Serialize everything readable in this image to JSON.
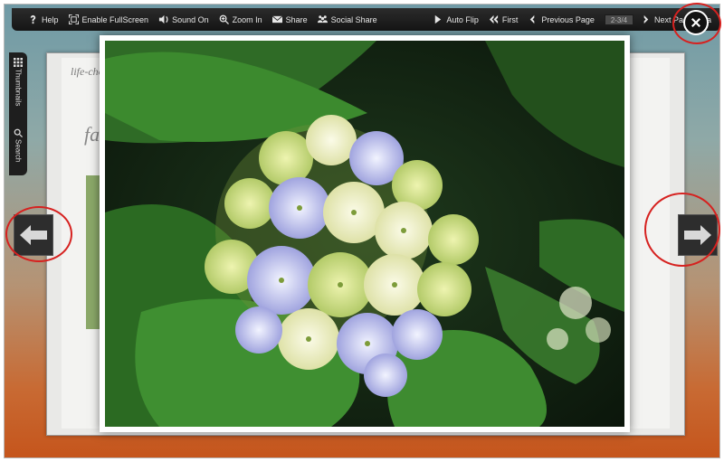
{
  "toolbar": {
    "help": "Help",
    "fullscreen": "Enable FullScreen",
    "sound": "Sound On",
    "zoom": "Zoom In",
    "share": "Share",
    "social": "Social Share",
    "autoflip": "Auto Flip",
    "first": "First",
    "previous": "Previous Page",
    "page_field": "2-3/4",
    "next": "Next Page",
    "last": "La"
  },
  "side_tabs": {
    "thumbnails": "Thumbnails",
    "search": "Search"
  },
  "book": {
    "page_header": "life-cho",
    "page_heading": "fas"
  },
  "icons": {
    "close": "close-icon",
    "prev": "arrow-left-icon",
    "next": "arrow-right-icon"
  },
  "colors": {
    "toolbar": "#1a1a1a",
    "highlight_ring": "#d6211f"
  }
}
